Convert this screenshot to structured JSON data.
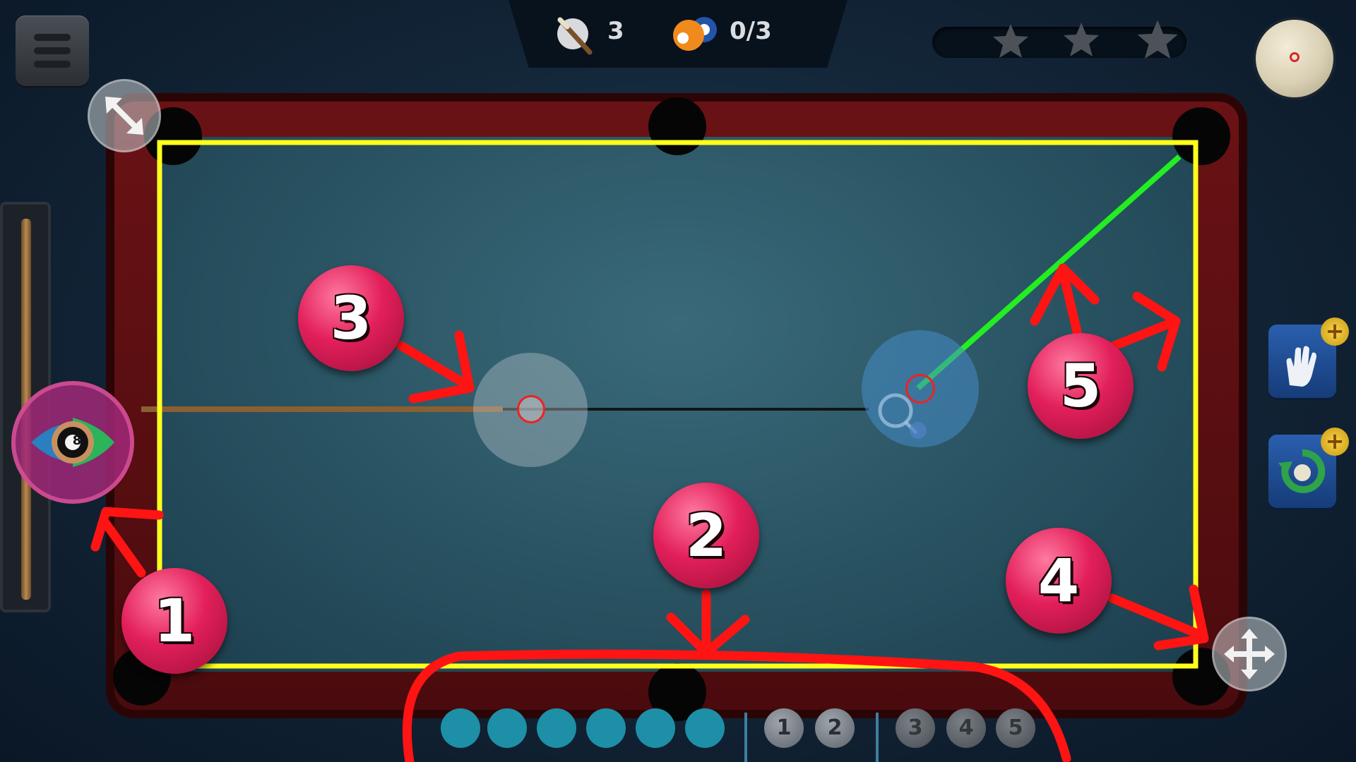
{
  "hud": {
    "shots_icon": "cue-stick-icon",
    "shots_value": "3",
    "pots_icon": "balls-icon",
    "pots_value": "0/3",
    "stars": [
      "star",
      "star",
      "star"
    ]
  },
  "buttons": {
    "menu_icon": "hamburger-icon",
    "resize_icon": "diagonal-resize-icon",
    "move_icon": "move-arrows-icon",
    "cue_ball_icon": "cue-ball-icon",
    "eye_icon": "eye-8-ball-icon",
    "glove_icon": "glove-icon",
    "spin_icon": "rotate-icon",
    "plus": "+"
  },
  "eight_ball_label": "8",
  "pocket_selector": {
    "pocket_slots": [
      "top-left",
      "top-middle",
      "top-right",
      "bottom-left",
      "bottom-middle",
      "bottom-right"
    ],
    "group_a": [
      "1",
      "2"
    ],
    "group_b": [
      "3",
      "4",
      "5"
    ]
  },
  "markers": [
    "1",
    "2",
    "3",
    "4",
    "5"
  ],
  "colors": {
    "highlight_frame": "#ffff1a",
    "aim_line": "#22ee22",
    "annotation_red": "#ff1414",
    "marker_pink": "#e21f5a",
    "felt": "#2a5463",
    "rail": "#5a0e11",
    "pocket_slot": "#1d8fa6"
  }
}
